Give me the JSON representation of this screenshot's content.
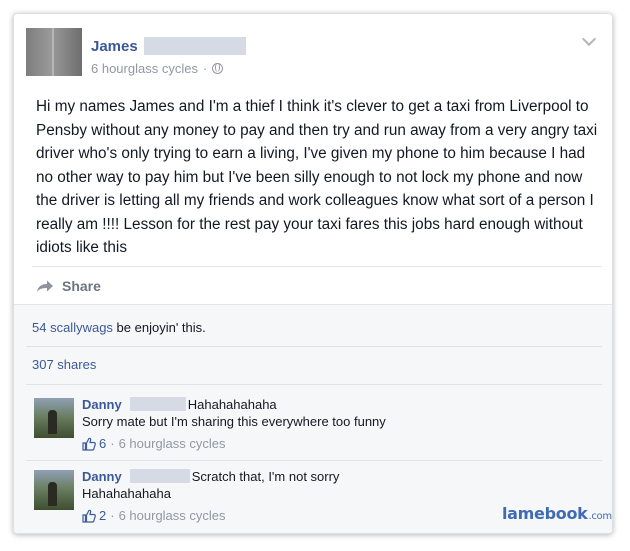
{
  "post": {
    "author": "James",
    "time": "6 hourglass cycles",
    "meta_separator": "·",
    "body": "Hi my names James and I'm a thief I think it's clever to get a taxi from Liverpool to Pensby without any money to pay and then try and run away from a very angry taxi driver who's only trying to earn a living, I've given my phone to him because I had no other way to pay him but I've been silly enough to not lock my phone and now the driver is letting all my friends and work colleagues know what sort of a person I really am !!!! Lesson for the rest pay your taxi fares this jobs hard enough without idiots like this"
  },
  "actions": {
    "share_label": "Share"
  },
  "feedback": {
    "likes_link": "54 scallywags",
    "likes_suffix": " be enjoyin' this.",
    "shares": "307 shares"
  },
  "comments": [
    {
      "name": "Danny",
      "text_inline": "Hahahahahaha",
      "text_line2": "Sorry mate but I'm sharing this everywhere too funny",
      "like_count": "6",
      "meta_sep": "·",
      "time": "6 hourglass cycles"
    },
    {
      "name": "Danny",
      "text_inline": "Scratch that, I'm not sorry",
      "text_line2": "Hahahahahaha",
      "like_count": "2",
      "meta_sep": "·",
      "time": "6 hourglass cycles"
    }
  ],
  "watermark": {
    "brand": "lamebook",
    "suffix": ".com"
  },
  "colors": {
    "link": "#3b5998",
    "meta": "#9197a3",
    "feedback_bg": "#f6f7f9",
    "watermark": "#3f6bb5"
  },
  "icons": [
    "chevron-down-icon",
    "globe-icon",
    "share-arrow-icon",
    "thumbs-up-icon"
  ]
}
